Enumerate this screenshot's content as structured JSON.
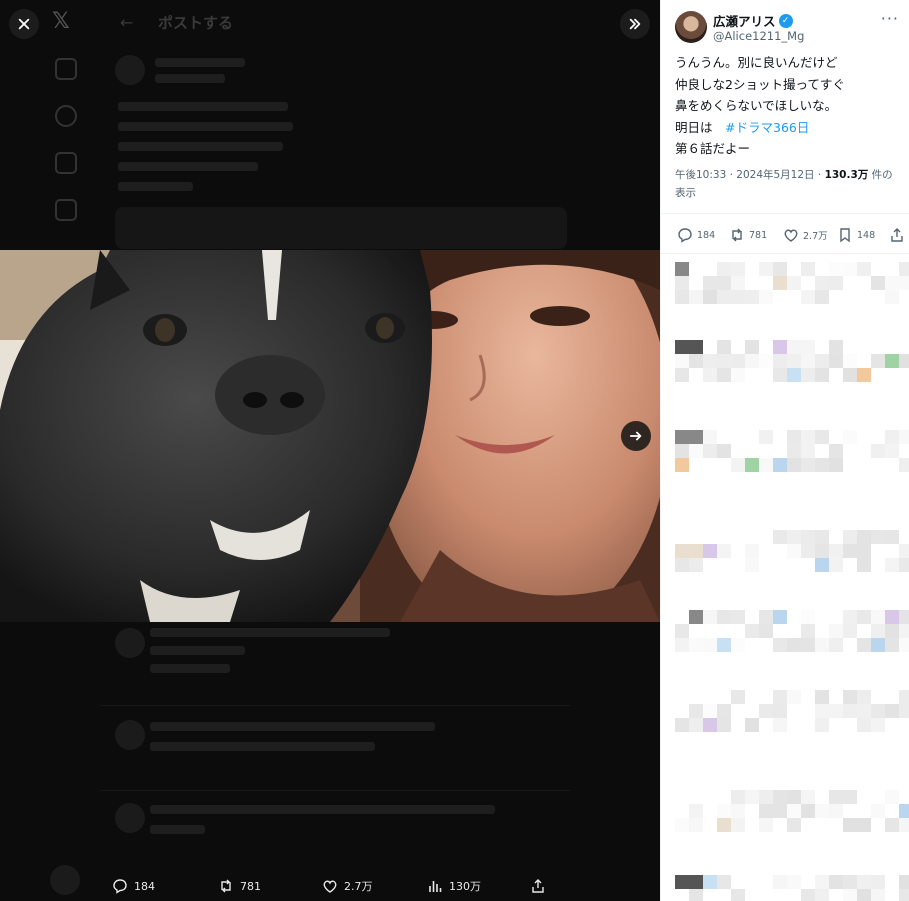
{
  "background": {
    "header_title": "ポストする",
    "nav_icons": [
      "home-icon",
      "search-icon",
      "notifications-icon",
      "messages-icon"
    ]
  },
  "media_viewer": {
    "close_icon": "close-icon",
    "collapse_icon": "chevron-double-right-icon",
    "next_icon": "arrow-right-icon",
    "actions": {
      "replies": "184",
      "reposts": "781",
      "likes": "2.7万",
      "views": "130万"
    }
  },
  "tweet": {
    "display_name": "広瀬アリス",
    "verified_icon": "verified-badge-icon",
    "handle": "@Alice1211_Mg",
    "text_lines": [
      "うんうん。別に良いんだけど",
      "仲良しな2ショット撮ってすぐ",
      "鼻をめくらないでほしいな。"
    ],
    "line4_prefix": "明日は　",
    "hashtag": "#ドラマ366日",
    "line5": "第６話だよー",
    "timestamp": "午後10:33 · 2024年5月12日 · ",
    "views_count": "130.3万",
    "views_suffix": " 件の表示",
    "actions": {
      "replies": "184",
      "reposts": "781",
      "likes": "2.7万",
      "bookmarks": "148"
    }
  },
  "colors": {
    "accent": "#1d9bf0",
    "text_primary": "#0f1419",
    "text_secondary": "#536471"
  }
}
